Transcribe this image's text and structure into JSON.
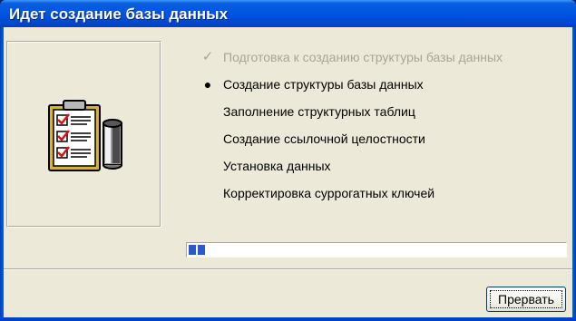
{
  "window": {
    "title": "Идет создание базы данных"
  },
  "steps": [
    {
      "label": "Подготовка к созданию структуры базы данных",
      "state": "done",
      "marker": "✓"
    },
    {
      "label": "Создание структуры базы данных",
      "state": "current",
      "marker": "●"
    },
    {
      "label": "Заполнение структурных таблиц",
      "state": "pending",
      "marker": ""
    },
    {
      "label": "Создание ссылочной целостности",
      "state": "pending",
      "marker": ""
    },
    {
      "label": "Установка данных",
      "state": "pending",
      "marker": ""
    },
    {
      "label": "Корректировка суррогатных ключей",
      "state": "pending",
      "marker": ""
    }
  ],
  "progress": {
    "fraction": 0.04
  },
  "buttons": {
    "cancel_label": "Прервать"
  },
  "icons": {
    "illustration": "checklist-clipboard-database-icon",
    "done_marker": "checkmark-icon",
    "current_marker": "bullet-icon"
  },
  "colors": {
    "titlebar": "#0055e5",
    "dialog_bg": "#ece9d8",
    "progress_fill": "#2a59c9",
    "done_text": "#a7a697"
  }
}
